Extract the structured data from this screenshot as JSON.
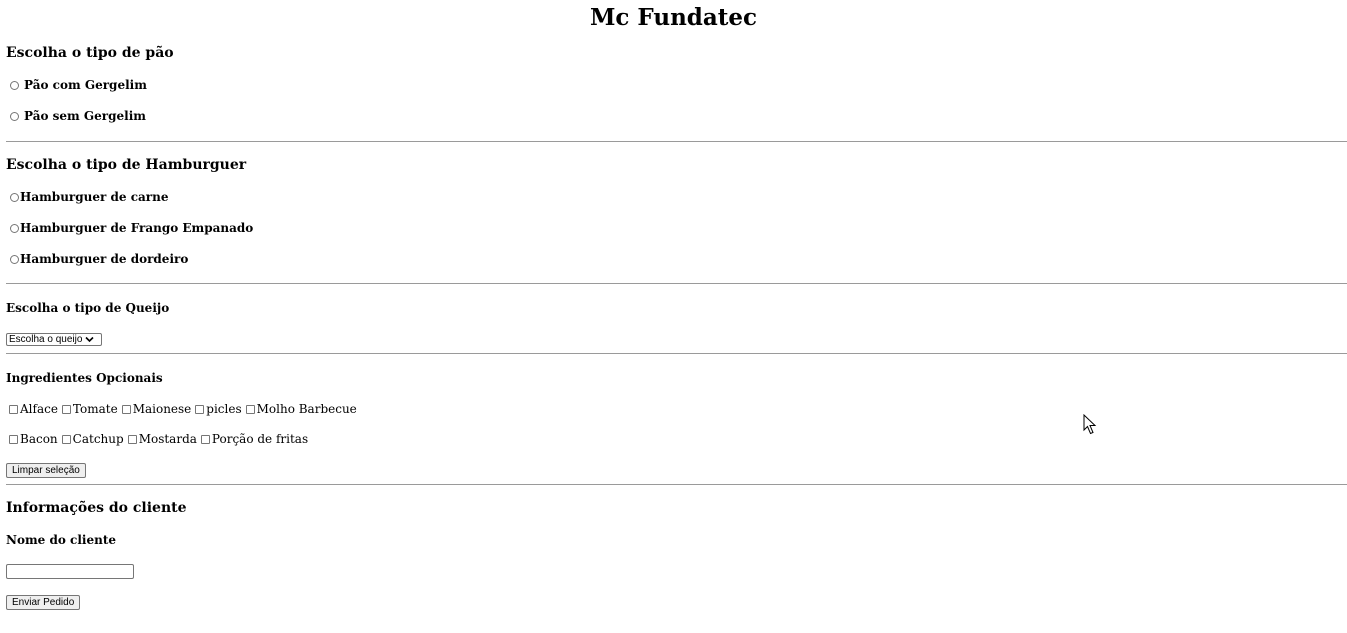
{
  "title": "Mc Fundatec",
  "bread": {
    "heading": "Escolha o tipo de pão",
    "options": [
      "Pão com Gergelim",
      "Pão sem Gergelim"
    ]
  },
  "burger": {
    "heading": "Escolha o tipo de Hamburguer",
    "options": [
      "Hamburguer de carne",
      "Hamburguer de Frango Empanado",
      "Hamburguer de dordeiro"
    ]
  },
  "cheese": {
    "heading": "Escolha o tipo de Queijo",
    "select_value": "Escolha o queijo"
  },
  "extras": {
    "heading": "Ingredientes Opcionais",
    "row1": [
      "Alface",
      "Tomate",
      "Maionese",
      "picles",
      "Molho Barbecue"
    ],
    "row2": [
      "Bacon",
      "Catchup",
      "Mostarda",
      "Porção de fritas"
    ],
    "clear_button": "Limpar seleção"
  },
  "client": {
    "heading": "Informações do cliente",
    "name_label": "Nome do cliente",
    "name_value": "",
    "submit_button": "Enviar Pedido"
  },
  "icons": {
    "select_arrow": "chevron-down-icon",
    "cursor": "mouse-pointer-icon"
  }
}
